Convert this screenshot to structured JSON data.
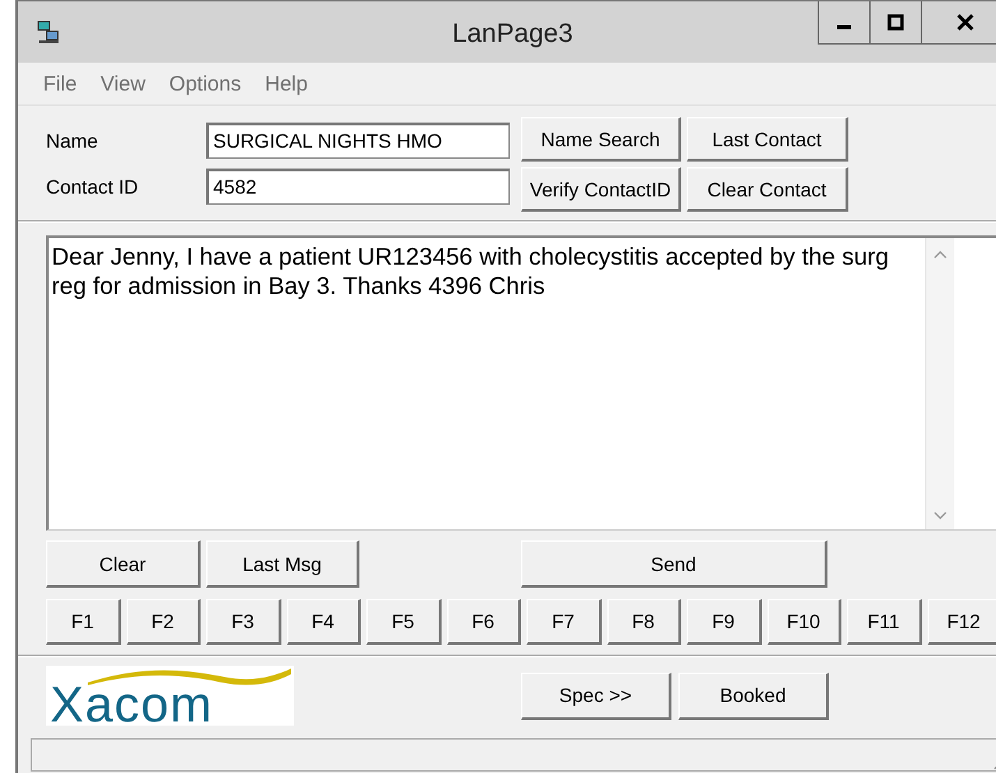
{
  "window": {
    "title": "LanPage3",
    "controls": [
      {
        "kind": "minimize"
      },
      {
        "kind": "maximize"
      },
      {
        "kind": "close"
      }
    ]
  },
  "menu": [
    "File",
    "View",
    "Options",
    "Help"
  ],
  "fields": [
    {
      "label": "Name",
      "value": "SURGICAL NIGHTS HMO"
    },
    {
      "label": "Contact ID",
      "value": "4582"
    }
  ],
  "contact_buttons": [
    "Name Search",
    "Last Contact",
    "Verify ContactID",
    "Clear Contact"
  ],
  "message": {
    "value": "Dear Jenny, I have a patient UR123456 with cholecystitis accepted by the surg reg for admission in Bay 3. Thanks 4396 Chris"
  },
  "action_buttons": [
    "Clear",
    "Last Msg",
    "Send"
  ],
  "function_keys": [
    "F1",
    "F2",
    "F3",
    "F4",
    "F5",
    "F6",
    "F7",
    "F8",
    "F9",
    "F10",
    "F11",
    "F12"
  ],
  "logo": {
    "text": "Xacom"
  },
  "bottom_buttons": [
    "Spec >>",
    "Booked"
  ]
}
